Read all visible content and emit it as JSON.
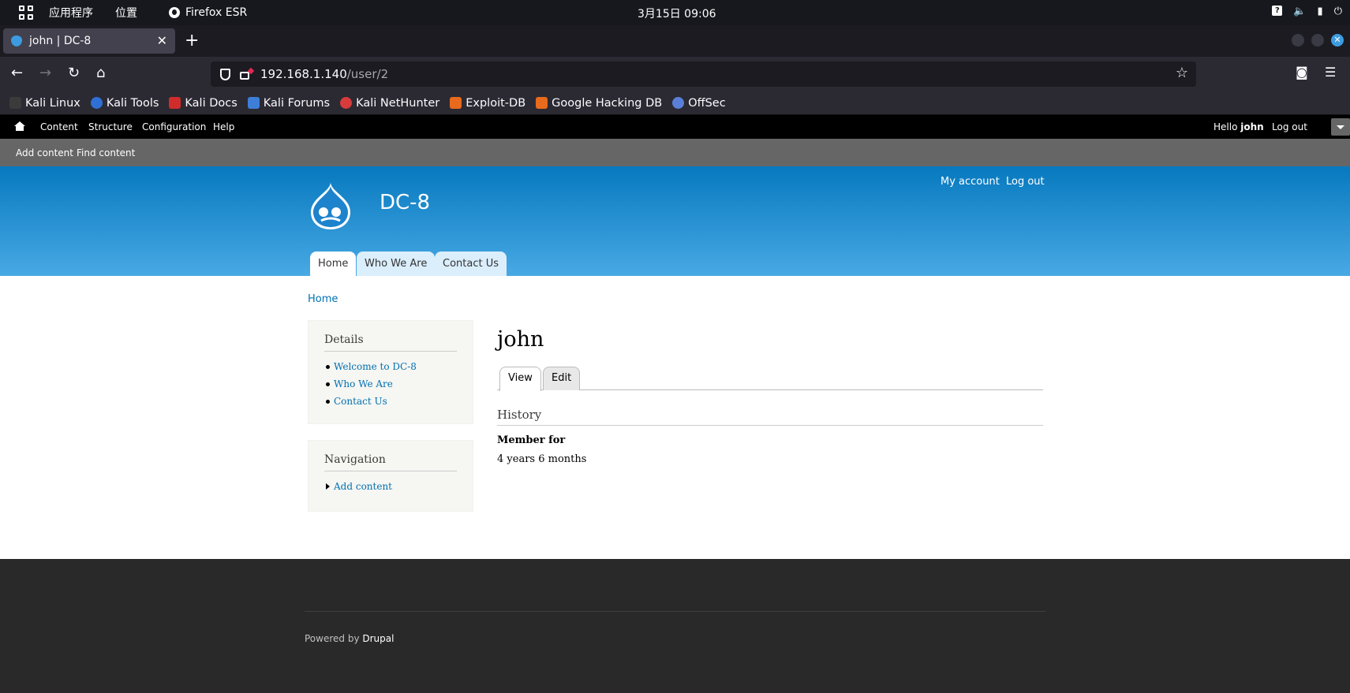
{
  "os": {
    "menu_apps": "应用程序",
    "menu_places": "位置",
    "active_app": "Firefox ESR",
    "clock": "3月15日  09:06"
  },
  "browser": {
    "tab_title": "john | DC-8",
    "url_host": "192.168.1.140",
    "url_path": "/user/2",
    "bookmarks": [
      "Kali Linux",
      "Kali Tools",
      "Kali Docs",
      "Kali Forums",
      "Kali NetHunter",
      "Exploit-DB",
      "Google Hacking DB",
      "OffSec"
    ]
  },
  "drupal_toolbar": {
    "items": [
      "Content",
      "Structure",
      "Configuration",
      "Help"
    ],
    "hello_prefix": "Hello ",
    "user": "john",
    "logout": "Log out",
    "shortcuts": [
      "Add content",
      "Find content"
    ]
  },
  "header": {
    "site_name": "DC-8",
    "secondary_menu": [
      "My account",
      "Log out"
    ],
    "primary_tabs": [
      "Home",
      "Who We Are",
      "Contact Us"
    ]
  },
  "breadcrumb": "Home",
  "sidebar": {
    "details_title": "Details",
    "details_links": [
      "Welcome to DC-8",
      "Who We Are",
      "Contact Us"
    ],
    "navigation_title": "Navigation",
    "navigation_links": [
      "Add content"
    ]
  },
  "main": {
    "title": "john",
    "tabs": [
      "View",
      "Edit"
    ],
    "section_title": "History",
    "member_label": "Member for",
    "member_value": "4 years 6 months"
  },
  "footer": {
    "powered_prefix": "Powered by ",
    "powered_link": "Drupal"
  }
}
